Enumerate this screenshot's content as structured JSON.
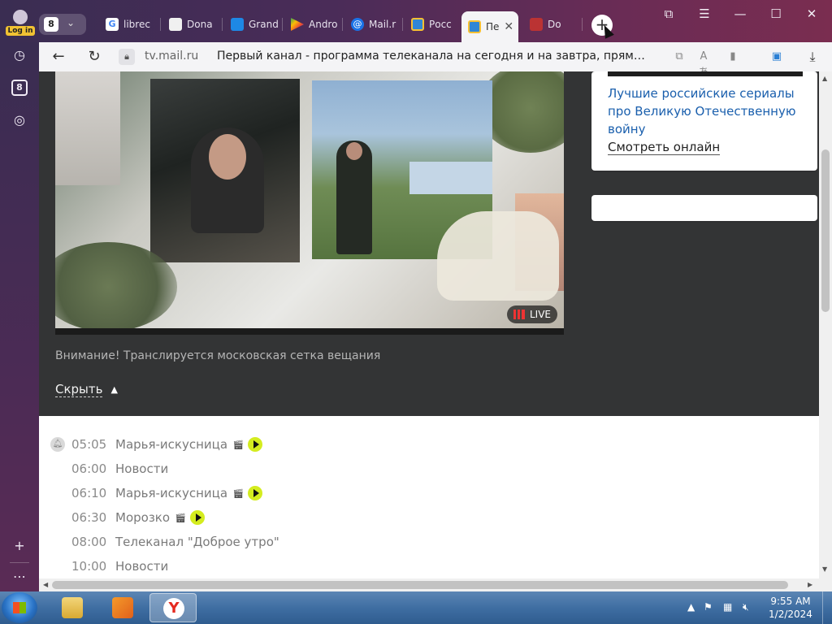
{
  "browser": {
    "profile_label": "Log in",
    "tab_count": "8",
    "tabs": [
      {
        "label": "librec",
        "icon": "google-icon",
        "color": "#ffffff"
      },
      {
        "label": "Dona",
        "icon": "document-icon",
        "color": "#ffffff"
      },
      {
        "label": "Grand",
        "icon": "grammar-icon",
        "color": "#1e88e5"
      },
      {
        "label": "Andro",
        "icon": "play-store-icon",
        "color": "#34a853"
      },
      {
        "label": "Mail.r",
        "icon": "mail-at-icon",
        "color": "#1a73e8"
      },
      {
        "label": "Росс",
        "icon": "tv-icon",
        "color": "#2f86d6"
      },
      {
        "label": "Пе",
        "icon": "tv-icon",
        "color": "#2f86d6",
        "active": true
      },
      {
        "label": "Do",
        "icon": "game-icon",
        "color": "#b33"
      }
    ],
    "new_tab_symbol": "+",
    "window_controls": [
      "bookmarks-icon",
      "menu-icon",
      "minimize-icon",
      "maximize-icon",
      "close-icon"
    ],
    "domain": "tv.mail.ru",
    "page_title": "Первый канал - программа телеканала на сегодня и на завтра, прям…"
  },
  "sidebar": {
    "badge": "8"
  },
  "player": {
    "live_label": "LIVE",
    "notice": "Внимание! Транслируется московская сетка вещания",
    "hide_label": "Скрыть"
  },
  "promo": {
    "link": "Лучшие российские сериалы про Великую Отечественную войну",
    "watch": "Смотреть онлайн"
  },
  "schedule": [
    {
      "time": "05:05",
      "title": "Марья-искусница",
      "film": true,
      "play": true,
      "bell": true
    },
    {
      "time": "06:00",
      "title": "Новости",
      "film": false,
      "play": false
    },
    {
      "time": "06:10",
      "title": "Марья-искусница",
      "film": true,
      "play": true
    },
    {
      "time": "06:30",
      "title": "Морозко",
      "film": true,
      "play": true
    },
    {
      "time": "08:00",
      "title": "Телеканал \"Доброе утро\"",
      "film": false,
      "play": false
    },
    {
      "time": "10:00",
      "title": "Новости",
      "film": false,
      "play": false
    }
  ],
  "taskbar": {
    "time": "9:55 AM",
    "date": "1/2/2024"
  }
}
